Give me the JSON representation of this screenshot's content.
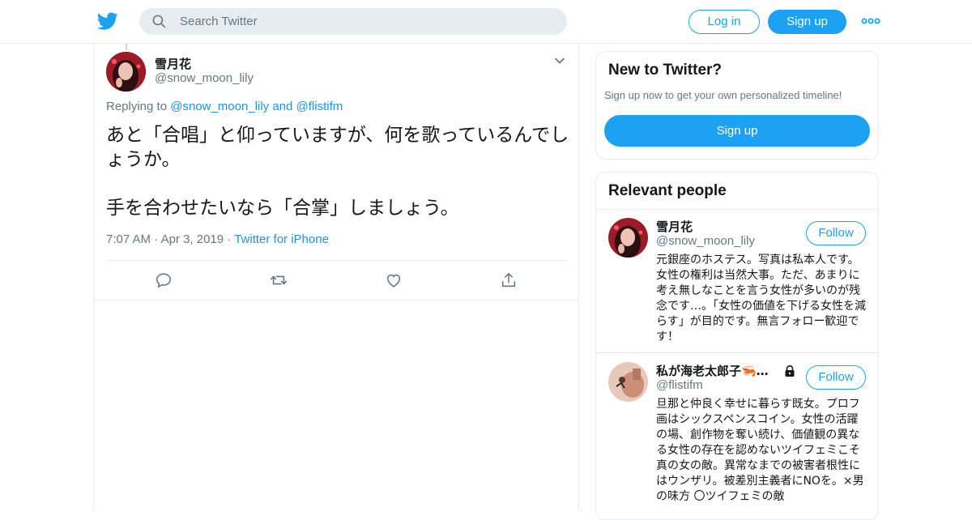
{
  "header": {
    "search_placeholder": "Search Twitter",
    "login_label": "Log in",
    "signup_label": "Sign up",
    "brand_color": "#1da1f2"
  },
  "tweet": {
    "author_name": "雪月花",
    "author_handle": "@snow_moon_lily",
    "replying_prefix": "Replying to",
    "replying_to_1": "@snow_moon_lily",
    "replying_and": "and",
    "replying_to_2": "@flistifm",
    "text": "あと「合唱」と仰っていますが、何を歌っているんでしょうか。\n\n手を合わせたいなら「合掌」しましょう。",
    "time": "7:07 AM",
    "date": "Apr 3, 2019",
    "source": "Twitter for iPhone"
  },
  "new_to_twitter": {
    "title": "New to Twitter?",
    "subtitle": "Sign up now to get your own personalized timeline!",
    "button_label": "Sign up"
  },
  "relevant_people": {
    "title": "Relevant people",
    "people": [
      {
        "name": "雪月花",
        "handle": "@snow_moon_lily",
        "follow_label": "Follow",
        "bio": "元銀座のホステス。写真は私本人です。 女性の権利は当然大事。ただ、あまりに考え無しなことを言う女性が多いのが残念です…。「女性の価値を下げる女性を減らす」が目的です。無言フォロー歓迎です！"
      },
      {
        "name": "私が海老太郎子🦐…",
        "handle": "@flistifm",
        "follow_label": "Follow",
        "protected": true,
        "bio": "旦那と仲良く幸せに暮らす既女。プロフ画はシックスペンスコイン。女性の活躍の場、創作物を奪い続け、価値観の異なる女性の存在を認めないツイフェミこそ真の女の敵。異常なまでの被害者根性にはウンザリ。被差別主義者にNOを。×男の味方 〇ツイフェミの敵"
      }
    ]
  },
  "icons": [
    "twitter-bird-icon",
    "search-icon",
    "more-icon",
    "chevron-down-icon",
    "reply-icon",
    "retweet-icon",
    "like-icon",
    "share-icon",
    "lock-icon"
  ]
}
